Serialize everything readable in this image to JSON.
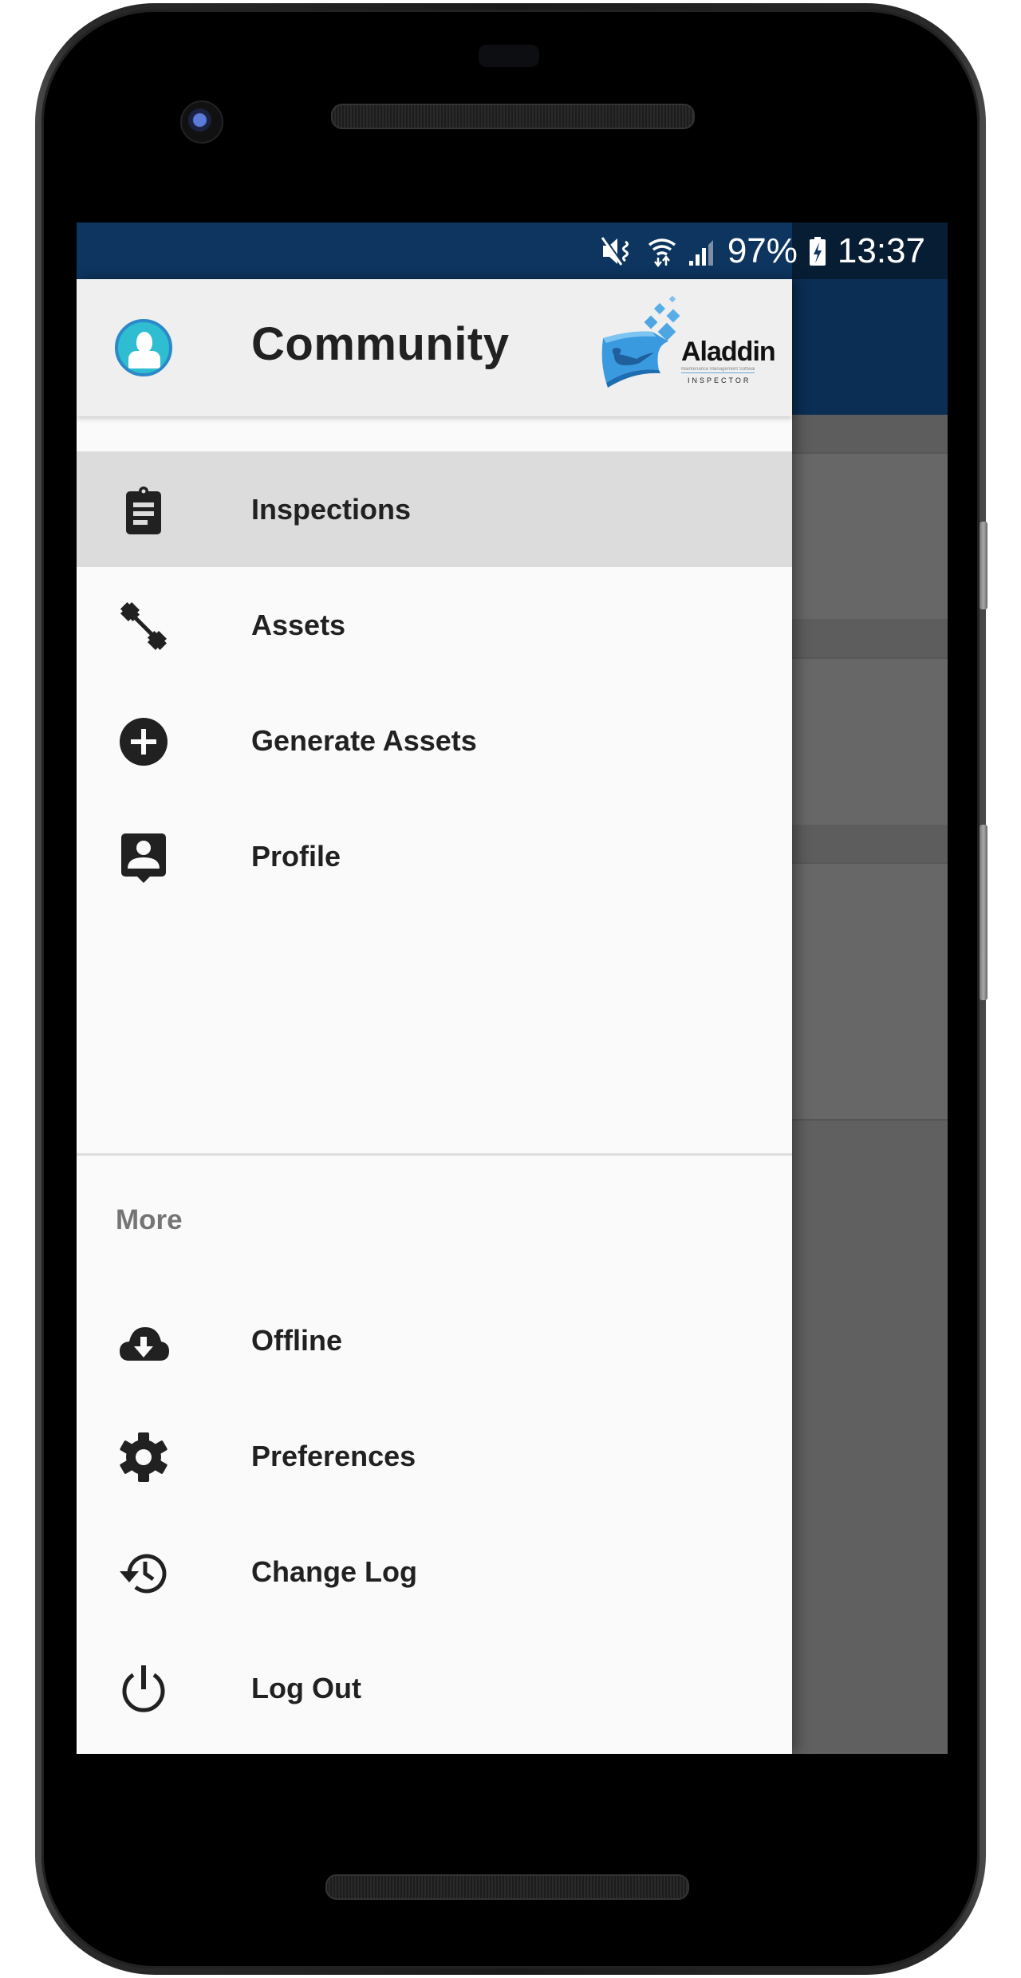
{
  "status_bar": {
    "icons": [
      "mute-icon",
      "wifi-icon",
      "signal-icon",
      "battery-charging-icon"
    ],
    "battery": "97%",
    "time": "13:37"
  },
  "drawer": {
    "header": {
      "title": "Community",
      "avatar_icon": "user-avatar-icon",
      "logo": {
        "name": "Aladdin",
        "tagline": "Maintenance Management Software",
        "product": "INSPECTOR"
      }
    },
    "items": [
      {
        "label": "Inspections",
        "icon": "clipboard-icon",
        "selected": true
      },
      {
        "label": "Assets",
        "icon": "dumbbell-icon",
        "selected": false
      },
      {
        "label": "Generate Assets",
        "icon": "add-circle-icon",
        "selected": false
      },
      {
        "label": "Profile",
        "icon": "contact-profile-icon",
        "selected": false
      }
    ],
    "section_label": "More",
    "more_items": [
      {
        "label": "Offline",
        "icon": "cloud-download-icon"
      },
      {
        "label": "Preferences",
        "icon": "gear-icon"
      },
      {
        "label": "Change Log",
        "icon": "history-icon"
      },
      {
        "label": "Log Out",
        "icon": "power-icon"
      }
    ]
  },
  "colors": {
    "app_bar": "#0d3560",
    "selected_item_bg": "#dcdcdc",
    "drawer_bg": "#fafafa",
    "header_bg": "#efefef",
    "avatar": "#2ebdd1"
  }
}
